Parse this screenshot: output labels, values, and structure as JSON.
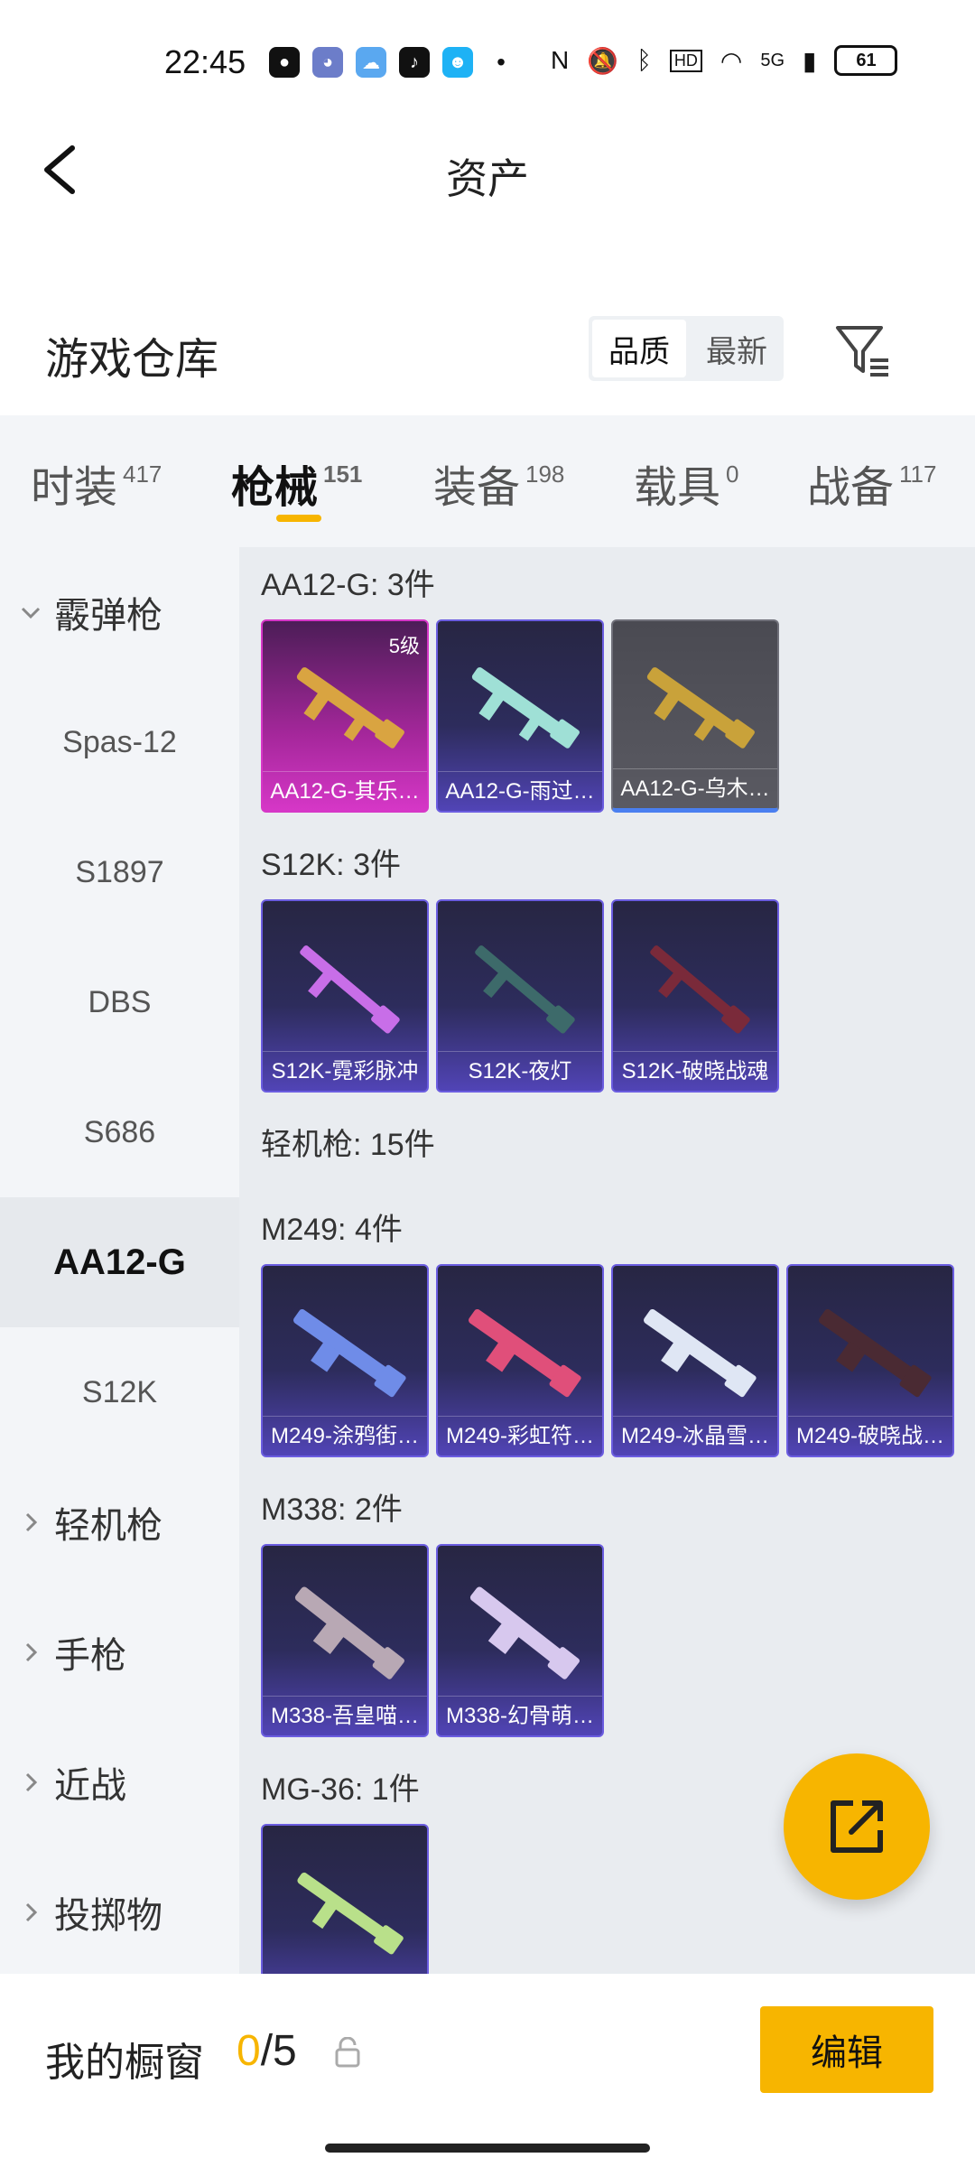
{
  "status_bar": {
    "time": "22:45",
    "network": "5G",
    "battery": "61"
  },
  "header": {
    "title": "资产"
  },
  "warehouse": {
    "title": "游戏仓库",
    "sort_options": [
      "品质",
      "最新"
    ]
  },
  "tabs": [
    {
      "label": "时装",
      "count": "417"
    },
    {
      "label": "枪械",
      "count": "151"
    },
    {
      "label": "装备",
      "count": "198"
    },
    {
      "label": "载具",
      "count": "0"
    },
    {
      "label": "战备",
      "count": "117"
    }
  ],
  "sidebar": {
    "items": [
      {
        "label": "霰弹枪",
        "type": "group-open"
      },
      {
        "label": "Spas-12",
        "type": "sub"
      },
      {
        "label": "S1897",
        "type": "sub"
      },
      {
        "label": "DBS",
        "type": "sub"
      },
      {
        "label": "S686",
        "type": "sub"
      },
      {
        "label": "AA12-G",
        "type": "sub-active"
      },
      {
        "label": "S12K",
        "type": "sub"
      },
      {
        "label": "轻机枪",
        "type": "group"
      },
      {
        "label": "手枪",
        "type": "group"
      },
      {
        "label": "近战",
        "type": "group"
      },
      {
        "label": "投掷物",
        "type": "group"
      }
    ]
  },
  "sections": [
    {
      "title": "AA12-G: 3件",
      "cards": [
        {
          "name": "AA12-G-其乐…",
          "level": "5级",
          "style": "pink",
          "gun_color": "#d9a441"
        },
        {
          "name": "AA12-G-雨过…",
          "level": "",
          "style": "purple",
          "gun_color": "#9fe0d6"
        },
        {
          "name": "AA12-G-乌木…",
          "level": "",
          "style": "gray",
          "gun_color": "#c9a23a"
        }
      ]
    },
    {
      "title": "S12K: 3件",
      "cards": [
        {
          "name": "S12K-霓彩脉冲",
          "level": "",
          "style": "purple",
          "gun_color": "#c86ee8"
        },
        {
          "name": "S12K-夜灯",
          "level": "",
          "style": "purple",
          "gun_color": "#3d6a6a"
        },
        {
          "name": "S12K-破晓战魂",
          "level": "",
          "style": "purple",
          "gun_color": "#7a2a3a"
        }
      ]
    },
    {
      "title": "轻机枪: 15件",
      "cards": []
    },
    {
      "title": "M249: 4件",
      "cards": [
        {
          "name": "M249-涂鸦街…",
          "level": "",
          "style": "purple",
          "gun_color": "#6f8ce8"
        },
        {
          "name": "M249-彩虹符…",
          "level": "",
          "style": "purple",
          "gun_color": "#e04f7a"
        },
        {
          "name": "M249-冰晶雪…",
          "level": "",
          "style": "purple",
          "gun_color": "#dfe6f4"
        },
        {
          "name": "M249-破晓战…",
          "level": "",
          "style": "purple",
          "gun_color": "#4a2a33"
        }
      ]
    },
    {
      "title": "M338: 2件",
      "cards": [
        {
          "name": "M338-吾皇喵…",
          "level": "",
          "style": "purple",
          "gun_color": "#b8a8b4"
        },
        {
          "name": "M338-幻骨萌…",
          "level": "",
          "style": "purple",
          "gun_color": "#d7c8ee"
        }
      ]
    },
    {
      "title": "MG-36: 1件",
      "cards": [
        {
          "name": "",
          "level": "",
          "style": "purple",
          "gun_color": "#b9e08a"
        }
      ]
    }
  ],
  "showcase": {
    "label": "我的橱窗",
    "current": "0",
    "total": "/5",
    "edit_label": "编辑"
  }
}
